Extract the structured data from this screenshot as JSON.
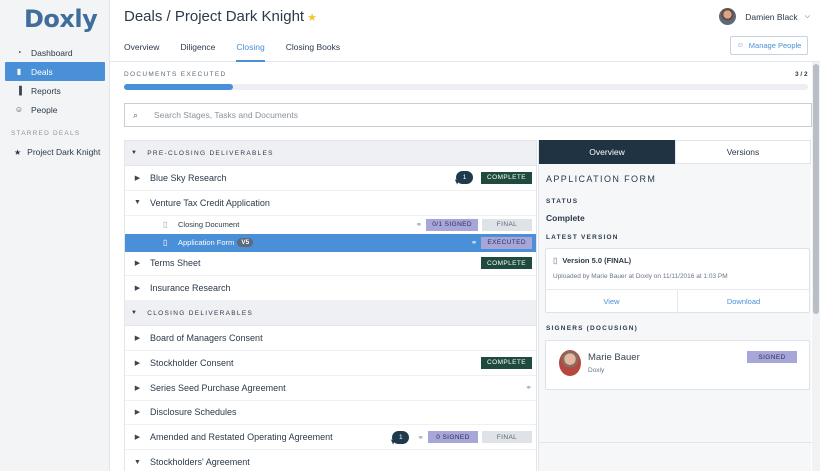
{
  "app": {
    "logo": "Doxly"
  },
  "sidebar": {
    "items": [
      {
        "label": "Dashboard",
        "icon": "dashboard-icon",
        "glyph": "◔",
        "active": false
      },
      {
        "label": "Deals",
        "icon": "document-icon",
        "glyph": "▮",
        "active": true
      },
      {
        "label": "Reports",
        "icon": "bar-chart-icon",
        "glyph": "▐",
        "active": false
      },
      {
        "label": "People",
        "icon": "people-icon",
        "glyph": "☺",
        "active": false
      }
    ],
    "starred_header": "STARRED DEALS",
    "starred": [
      {
        "label": "Project Dark Knight",
        "glyph": "★"
      }
    ]
  },
  "header": {
    "title": "Deals / Project Dark Knight",
    "star_glyph": "★",
    "tabs": [
      {
        "label": "Overview",
        "active": false
      },
      {
        "label": "Diligence",
        "active": false
      },
      {
        "label": "Closing",
        "active": true
      },
      {
        "label": "Closing Books",
        "active": false
      }
    ],
    "user_name": "Damien Black",
    "user_chevron": "⌵",
    "manage_people": "Manage People",
    "manage_glyph": "☺"
  },
  "progress": {
    "label": "DOCUMENTS EXECUTED",
    "count": "3 / 2",
    "fraction": 0.16
  },
  "search": {
    "placeholder": "Search Stages, Tasks and Documents",
    "value": "",
    "glyph": "⌕"
  },
  "sections": [
    {
      "title": "PRE-CLOSING DELIVERABLES",
      "rows": [
        {
          "name": "Blue Sky Research",
          "expanded": false,
          "comments": "1",
          "badges": [
            {
              "text": "COMPLETE",
              "type": "complete"
            }
          ]
        },
        {
          "name": "Venture Tax Credit Application",
          "expanded": true,
          "badges": [],
          "children": [
            {
              "name": "Closing Document",
              "link": true,
              "badges": [
                {
                  "text": "0/1 SIGNED",
                  "type": "signed-lav"
                },
                {
                  "text": "FINAL",
                  "type": "final"
                }
              ]
            },
            {
              "name": "Application Form",
              "version": "V5",
              "selected": true,
              "link": true,
              "badges": [
                {
                  "text": "EXECUTED",
                  "type": "executed"
                }
              ]
            }
          ]
        },
        {
          "name": "Terms Sheet",
          "expanded": false,
          "badges": [
            {
              "text": "COMPLETE",
              "type": "complete"
            }
          ]
        },
        {
          "name": "Insurance Research",
          "expanded": false,
          "badges": []
        }
      ]
    },
    {
      "title": "CLOSING DELIVERABLES",
      "rows": [
        {
          "name": "Board of Managers Consent",
          "expanded": false,
          "badges": []
        },
        {
          "name": "Stockholder Consent",
          "expanded": false,
          "badges": [
            {
              "text": "COMPLETE",
              "type": "complete"
            }
          ]
        },
        {
          "name": "Series Seed Purchase Agreement",
          "expanded": false,
          "link": true,
          "badges": []
        },
        {
          "name": "Disclosure Schedules",
          "expanded": false,
          "badges": []
        },
        {
          "name": "Amended and Restated Operating Agreement",
          "expanded": false,
          "comments": "1",
          "link": true,
          "badges": [
            {
              "text": "0 SIGNED",
              "type": "signed-lav"
            },
            {
              "text": "FINAL",
              "type": "final"
            }
          ]
        },
        {
          "name": "Stockholders' Agreement",
          "expanded": true,
          "badges": []
        }
      ]
    }
  ],
  "glyphs": {
    "collapsed": "▶",
    "expanded": "▼",
    "doc": "▯",
    "link": "⚭"
  },
  "panel": {
    "tabs": [
      {
        "label": "Overview",
        "active": true
      },
      {
        "label": "Versions",
        "active": false
      }
    ],
    "title": "APPLICATION FORM",
    "status_label": "STATUS",
    "status_value": "Complete",
    "latest_label": "LATEST VERSION",
    "version_name": "Version 5.0 (FINAL)",
    "version_meta": "Uploaded by Marie Bauer at Doxly on 11/11/2016 at 1:03 PM",
    "view_label": "View",
    "download_label": "Download",
    "signers_label": "SIGNERS (DOCUSIGN)",
    "signer_name": "Marie Bauer",
    "signer_company": "Doxly",
    "signer_status": "SIGNED"
  },
  "colors": {
    "accent": "#4a90d9",
    "complete": "#1f4a3e",
    "signed": "#a7a6d9",
    "panel_tab_active": "#1f3343"
  }
}
